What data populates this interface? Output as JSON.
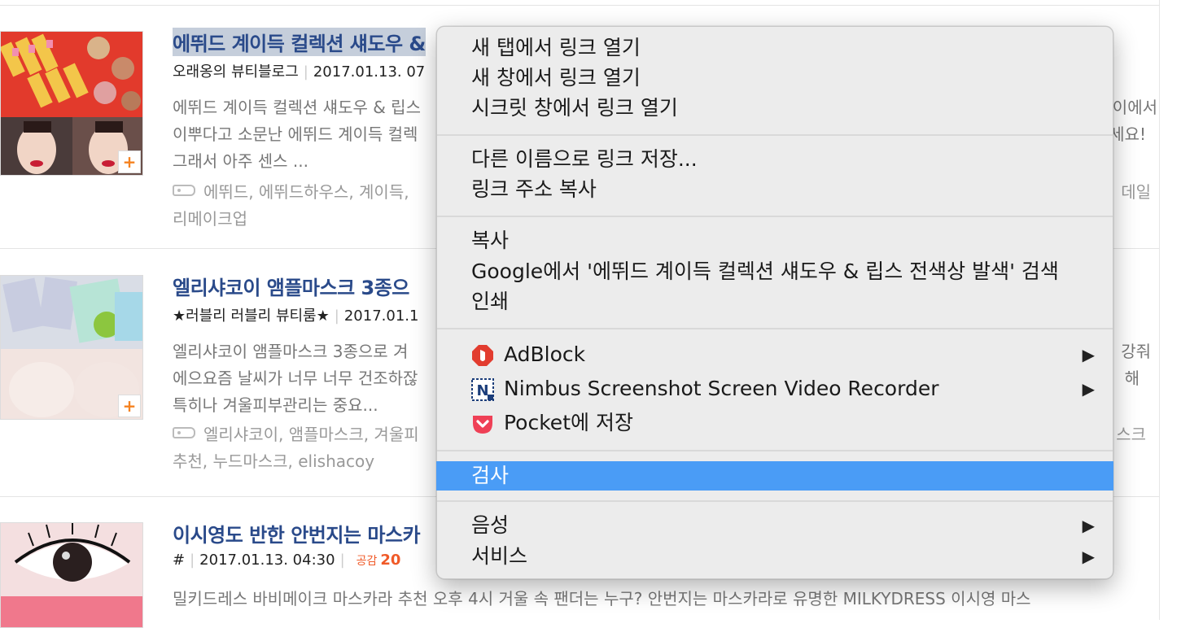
{
  "items": [
    {
      "title": "에뛰드 계이득 컬렉션 섀도우 &",
      "blog": "오래옹의 뷰티블로그",
      "date": "2017.01.13. 07",
      "desc_left_1": "에뛰드 계이득 컬렉션 섀도우 & 립스",
      "desc_right_1": "이에서",
      "desc_left_2": "이뿌다고 소문난 에뛰드 계이득 컬렉",
      "desc_right_2": "세요!",
      "desc_line3": "그래서 아주 센스 ...",
      "tags_left": "에뛰드, 에뛰드하우스, 계이득,",
      "tags_right": "데일",
      "tags_line2": "리메이크업"
    },
    {
      "title": "엘리샤코이 앰플마스크 3종으",
      "blog": "★러블리 러블리 뷰티룸★",
      "date": "2017.01.1",
      "desc_left_1": "엘리샤코이 앰플마스크 3종으로 겨",
      "desc_right_1": "강줘",
      "desc_left_2": "에으요즘 날씨가 너무 너무 건조하잖",
      "desc_right_2": "해",
      "desc_line3": "특히나 겨울피부관리는 중요...",
      "tags_left": "엘리샤코이, 앰플마스크, 겨울피",
      "tags_right": "스크",
      "tags_line2": "추천, 누드마스크, elishacoy"
    },
    {
      "title": "이시영도 반한 안번지는 마스카",
      "blog": "#",
      "date": "2017.01.13. 04:30",
      "like_label": "공감",
      "like_count": "20",
      "desc_line1": "밀키드레스 바비메이크 마스카라 추천 오후 4시 거울 속 팬더는 누구? 안번지는 마스카라로 유명한 MILKYDRESS 이시영 마스"
    }
  ],
  "thumb_plus": "+",
  "context_menu": {
    "group1": [
      "새 탭에서 링크 열기",
      "새 창에서 링크 열기",
      "시크릿 창에서 링크 열기"
    ],
    "group2": [
      "다른 이름으로 링크 저장...",
      "링크 주소 복사"
    ],
    "group3": [
      "복사",
      "Google에서 '에뛰드 계이득 컬렉션 섀도우 & 립스 전색상 발색' 검색",
      "인쇄"
    ],
    "extensions": [
      {
        "label": "AdBlock",
        "icon": "adblock-icon",
        "has_submenu": true,
        "color": "#e23c2f"
      },
      {
        "label": "Nimbus Screenshot  Screen Video Recorder",
        "icon": "nimbus-icon",
        "has_submenu": true,
        "color": "#1b3d7a"
      },
      {
        "label": "Pocket에 저장",
        "icon": "pocket-icon",
        "has_submenu": false,
        "color": "#ef4056"
      }
    ],
    "inspect": "검사",
    "group5": [
      {
        "label": "음성",
        "has_submenu": true
      },
      {
        "label": "서비스",
        "has_submenu": true
      }
    ],
    "submenu_arrow": "▶",
    "highlight_color": "#4a9cf6"
  }
}
